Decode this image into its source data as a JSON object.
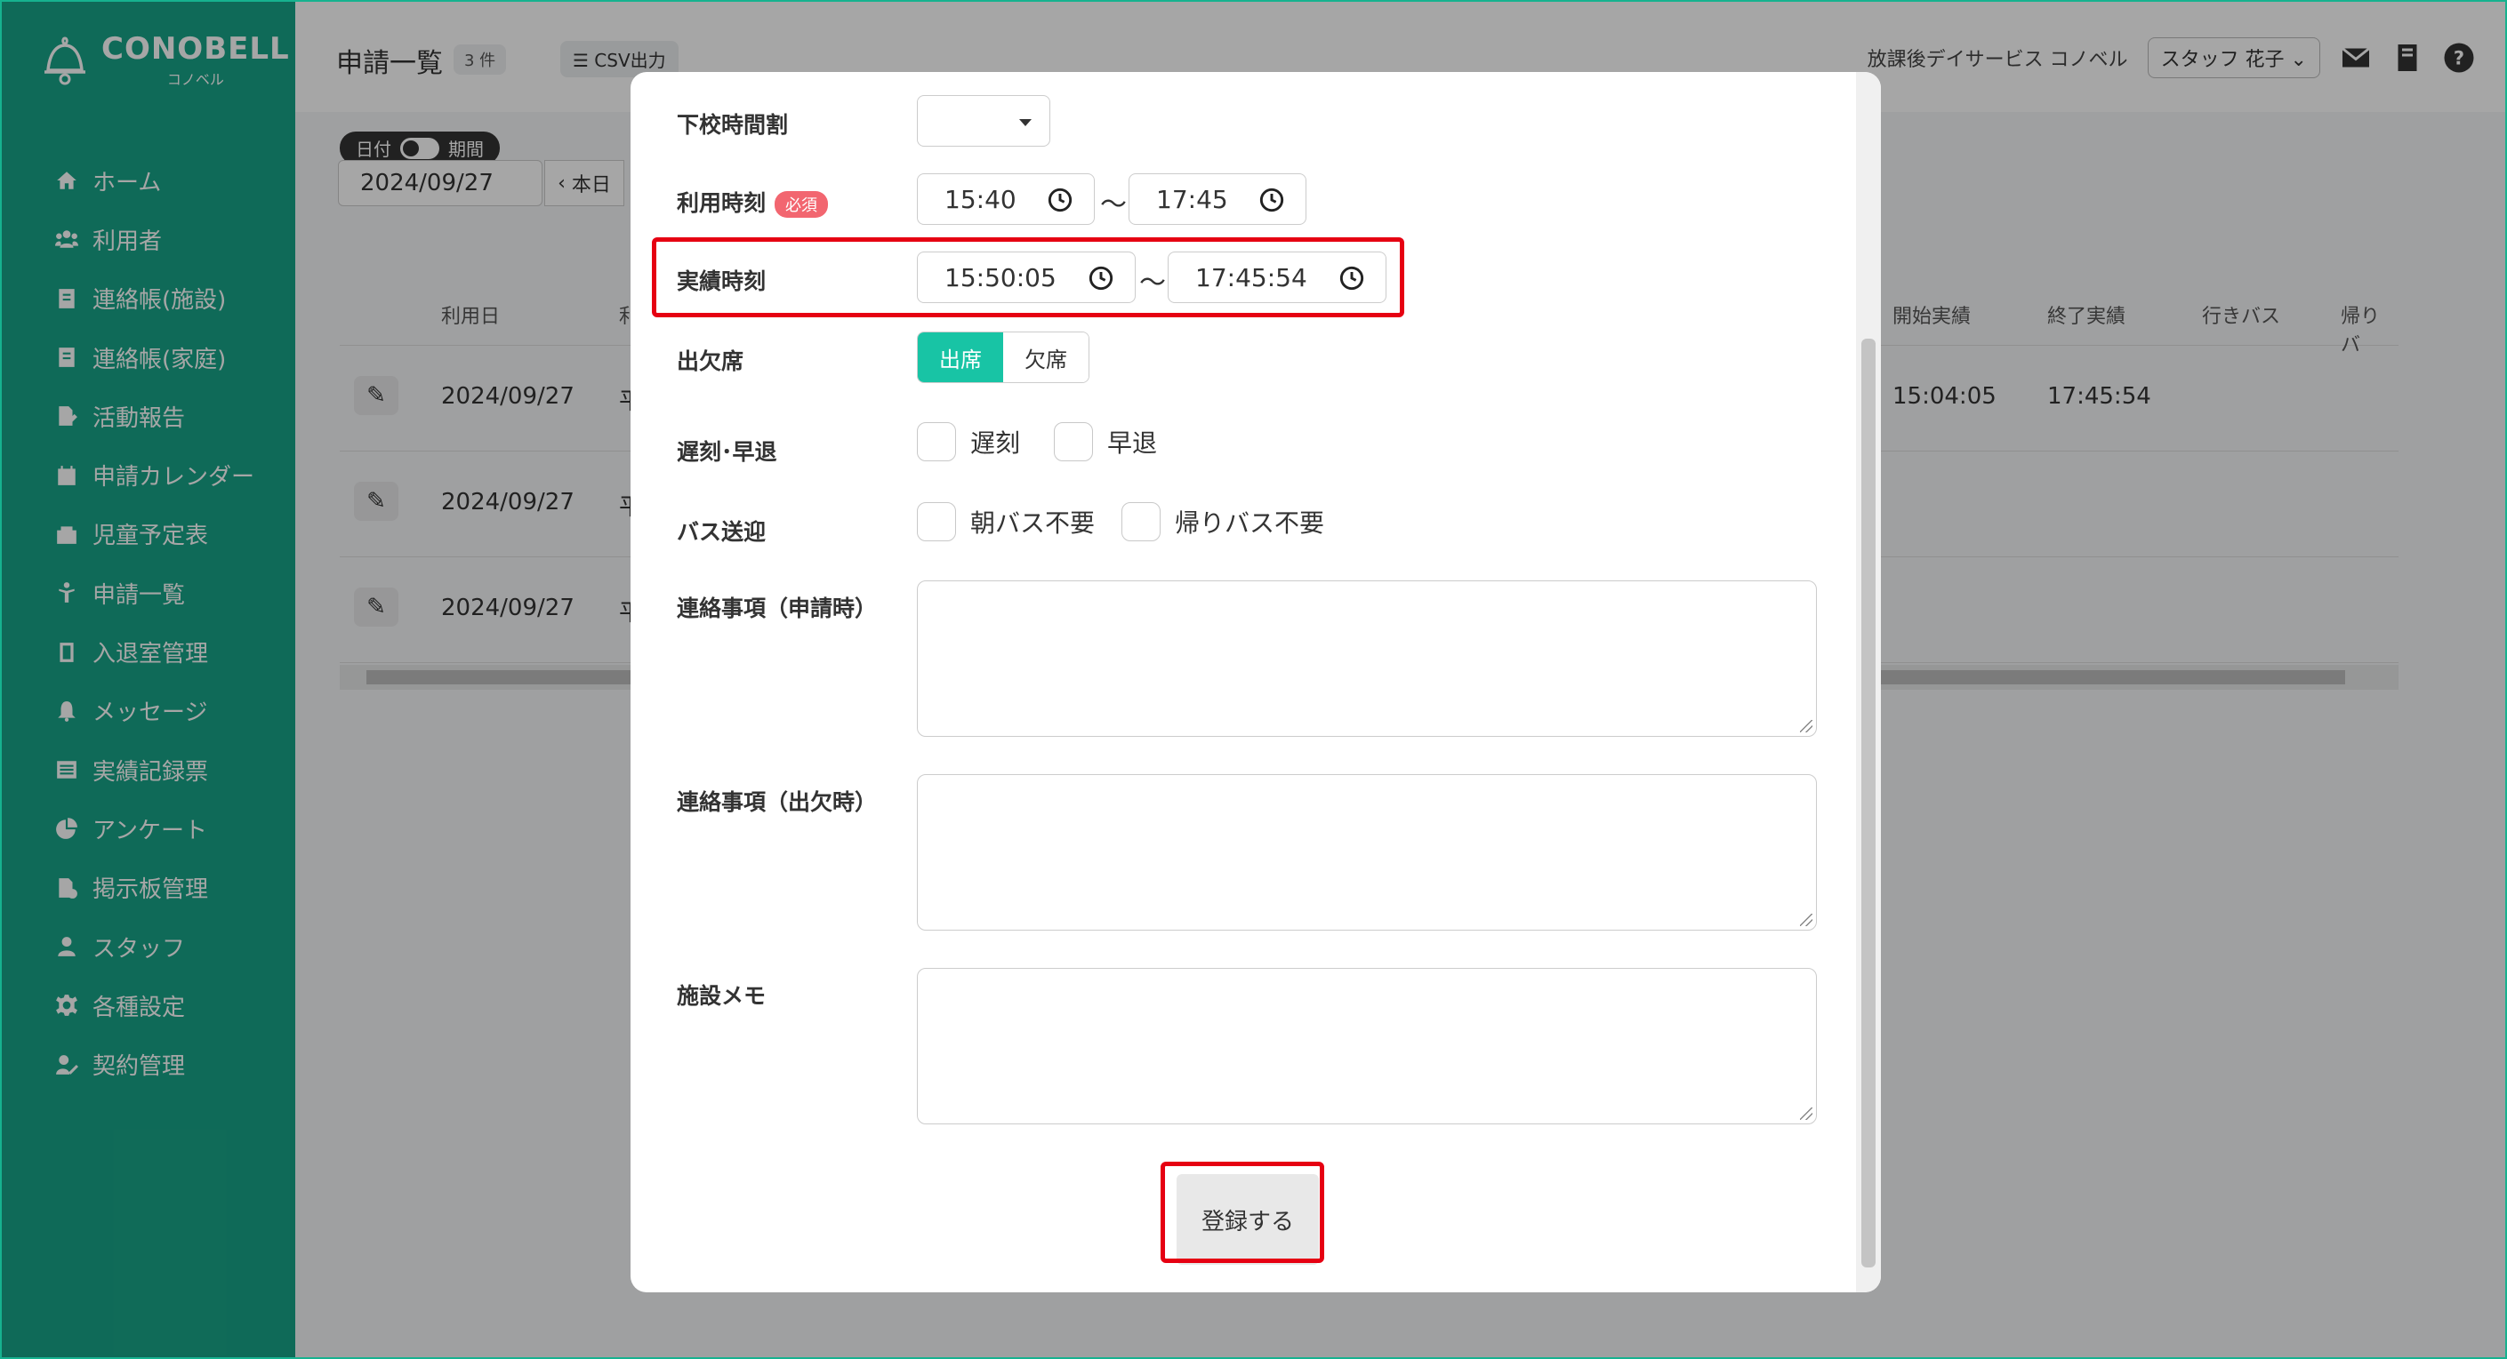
{
  "brand": {
    "name": "CONOBELL",
    "sub": "コノベル"
  },
  "sidebar": {
    "items": [
      {
        "label": "ホーム",
        "icon": "home-icon"
      },
      {
        "label": "利用者",
        "icon": "users-icon"
      },
      {
        "label": "連絡帳(施設)",
        "icon": "notebook-icon"
      },
      {
        "label": "連絡帳(家庭)",
        "icon": "notebook-icon"
      },
      {
        "label": "活動報告",
        "icon": "report-icon"
      },
      {
        "label": "申請カレンダー",
        "icon": "calendar-icon"
      },
      {
        "label": "児童予定表",
        "icon": "schedule-icon"
      },
      {
        "label": "申請一覧",
        "icon": "child-icon"
      },
      {
        "label": "入退室管理",
        "icon": "tablet-icon"
      },
      {
        "label": "メッセージ",
        "icon": "bell-icon"
      },
      {
        "label": "実績記録票",
        "icon": "table-icon"
      },
      {
        "label": "アンケート",
        "icon": "pie-chart-icon"
      },
      {
        "label": "掲示板管理",
        "icon": "board-icon"
      },
      {
        "label": "スタッフ",
        "icon": "staff-icon"
      },
      {
        "label": "各種設定",
        "icon": "gear-icon"
      },
      {
        "label": "契約管理",
        "icon": "contract-icon"
      }
    ]
  },
  "header": {
    "title": "申請一覧",
    "count": "3 件",
    "csv_label": "CSV出力",
    "facility": "放課後デイサービス コノベル",
    "staff": "スタッフ 花子"
  },
  "filters": {
    "toggle_left": "日付",
    "toggle_right": "期間",
    "date": "2024/09/27",
    "today": "本日"
  },
  "table": {
    "headers": {
      "date": "利用日",
      "cut": "利",
      "start_actual": "開始実績",
      "end_actual": "終了実績",
      "bus_go": "行きバス",
      "bus_back": "帰りバ"
    },
    "rows": [
      {
        "date": "2024/09/27",
        "cut": "平",
        "start": "15:04:05",
        "end": "17:45:54"
      },
      {
        "date": "2024/09/27",
        "cut": "平",
        "start": "",
        "end": ""
      },
      {
        "date": "2024/09/27",
        "cut": "平",
        "start": "",
        "end": ""
      }
    ]
  },
  "modal": {
    "fields": {
      "school_time": "下校時間割",
      "use_time": "利用時刻",
      "required": "必須",
      "actual_time": "実績時刻",
      "attendance": "出欠席",
      "late_early": "遅刻･早退",
      "bus": "バス送迎",
      "note_apply": "連絡事項（申請時）",
      "note_attend": "連絡事項（出欠時）",
      "facility_memo": "施設メモ"
    },
    "use_start": "15:40",
    "use_end": "17:45",
    "actual_start": "15:50:05",
    "actual_end": "17:45:54",
    "tilde": "〜",
    "present": "出席",
    "absent": "欠席",
    "late": "遅刻",
    "early": "早退",
    "no_morning_bus": "朝バス不要",
    "no_return_bus": "帰りバス不要",
    "submit": "登録する"
  },
  "colors": {
    "sidebar": "#18a487",
    "accent": "#18c4a5",
    "highlight": "#e60012",
    "required": "#f26670"
  }
}
